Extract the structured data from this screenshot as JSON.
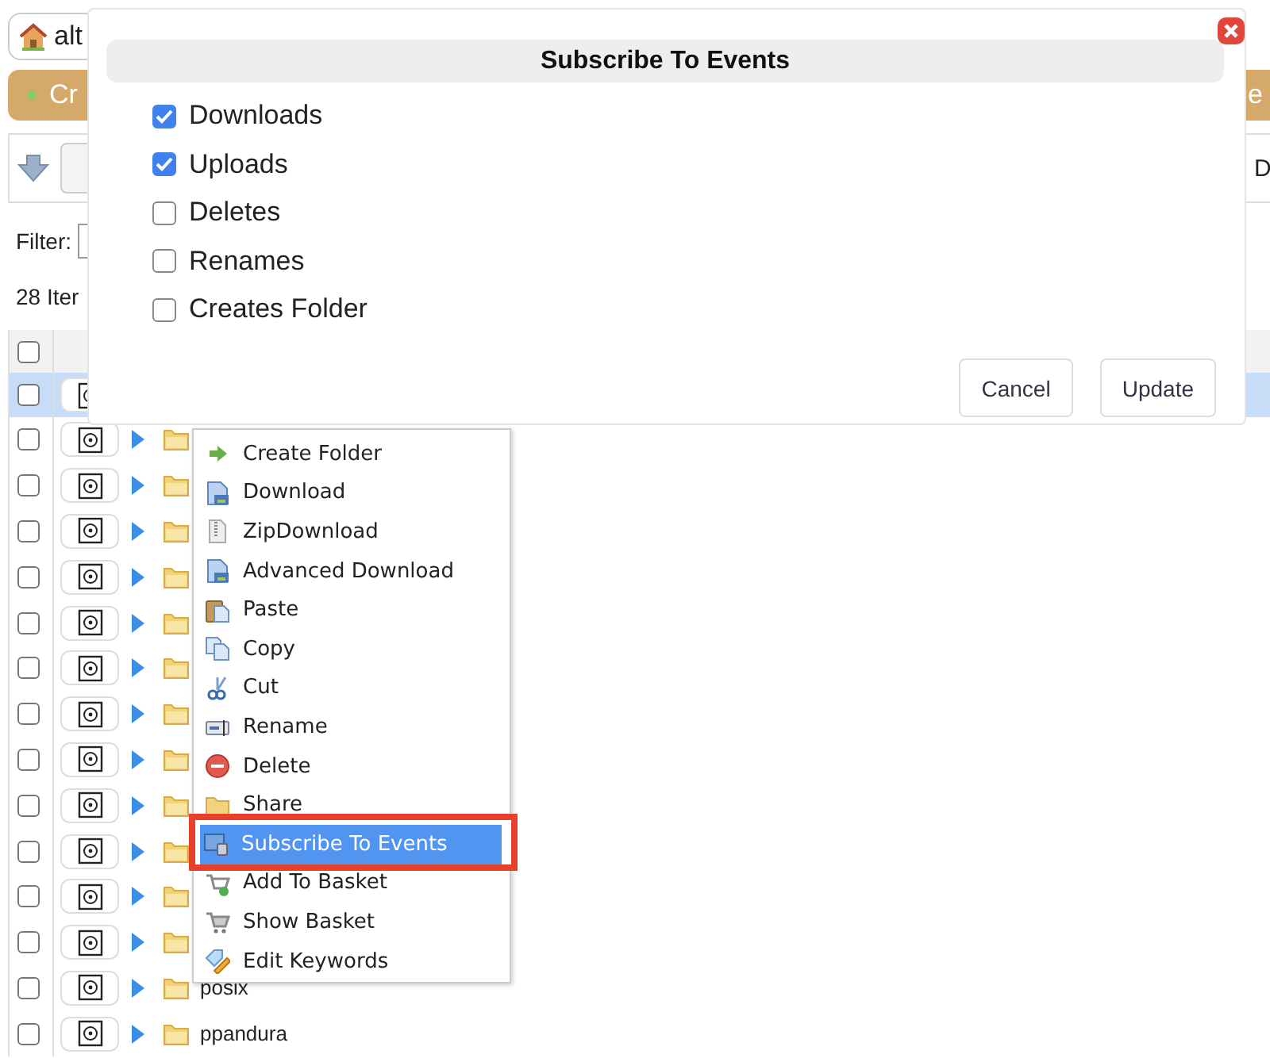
{
  "location_bar": {
    "text": "alt"
  },
  "action_buttons": [
    {
      "label": "Cr"
    },
    {
      "label": "e"
    }
  ],
  "toolbar": {
    "button_label": "D"
  },
  "filter": {
    "label": "Filter:"
  },
  "item_count": "28 Iter",
  "table": {
    "header_checked": false,
    "rows": [
      {
        "selected": true,
        "checked": false
      },
      {
        "selected": false,
        "checked": false
      },
      {
        "selected": false,
        "checked": false
      },
      {
        "selected": false,
        "checked": false
      },
      {
        "selected": false,
        "checked": false
      },
      {
        "selected": false,
        "checked": false
      },
      {
        "selected": false,
        "checked": false
      },
      {
        "selected": false,
        "checked": false
      },
      {
        "selected": false,
        "checked": false
      },
      {
        "selected": false,
        "checked": false
      },
      {
        "selected": false,
        "checked": false
      },
      {
        "selected": false,
        "checked": false
      },
      {
        "selected": false,
        "checked": false
      },
      {
        "selected": false,
        "checked": false,
        "name": "posix"
      },
      {
        "selected": false,
        "checked": false,
        "name": "ppandura"
      }
    ]
  },
  "dialog": {
    "title": "Subscribe To Events",
    "options": [
      {
        "label": "Downloads",
        "checked": true
      },
      {
        "label": "Uploads",
        "checked": true
      },
      {
        "label": "Deletes",
        "checked": false
      },
      {
        "label": "Renames",
        "checked": false
      },
      {
        "label": "Creates Folder",
        "checked": false
      }
    ],
    "buttons": [
      "Cancel",
      "Update"
    ]
  },
  "context_menu": {
    "items": [
      {
        "label": "Create Folder",
        "selected": false
      },
      {
        "label": "Download",
        "selected": false
      },
      {
        "label": "ZipDownload",
        "selected": false
      },
      {
        "label": "Advanced Download",
        "selected": false
      },
      {
        "label": "Paste",
        "selected": false
      },
      {
        "label": "Copy",
        "selected": false
      },
      {
        "label": "Cut",
        "selected": false
      },
      {
        "label": "Rename",
        "selected": false
      },
      {
        "label": "Delete",
        "selected": false
      },
      {
        "label": "Share",
        "selected": false
      },
      {
        "label": "Subscribe To Events",
        "selected": true,
        "outlined": true
      },
      {
        "label": "Add To Basket",
        "selected": false
      },
      {
        "label": "Show Basket",
        "selected": false
      },
      {
        "label": "Edit Keywords",
        "selected": false
      }
    ]
  }
}
